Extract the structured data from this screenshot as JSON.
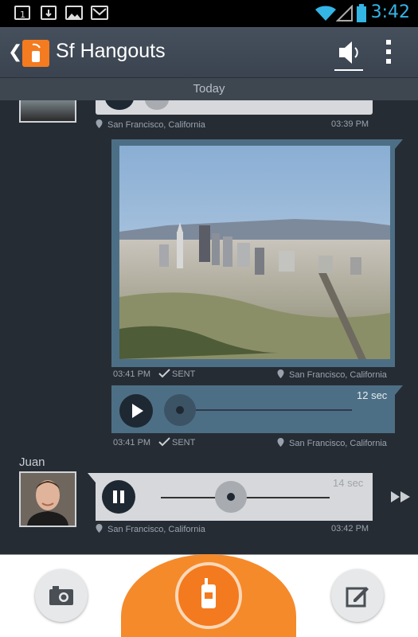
{
  "status_bar": {
    "time": "3:42",
    "notification_icons": [
      "sim-one-icon",
      "download-icon",
      "image-icon",
      "gmail-icon"
    ],
    "system_icons": [
      "wifi-icon",
      "signal-icon",
      "battery-icon"
    ],
    "time_color": "#33b5e5"
  },
  "action_bar": {
    "title": "Sf Hangouts",
    "actions": [
      "speaker-icon",
      "overflow-menu-icon"
    ]
  },
  "conversation": {
    "day_header": "Today",
    "messages": [
      {
        "type": "audio",
        "direction": "received",
        "location": "San Francisco, California",
        "time": "03:39 PM"
      },
      {
        "type": "photo",
        "direction": "sent",
        "time": "03:41 PM",
        "status": "SENT",
        "location": "San Francisco, California"
      },
      {
        "type": "audio",
        "direction": "sent",
        "duration": "12 sec",
        "time": "03:41 PM",
        "status": "SENT",
        "location": "San Francisco, California"
      },
      {
        "type": "audio",
        "direction": "received",
        "sender": "Juan",
        "duration": "14 sec",
        "location": "San Francisco, California",
        "time": "03:42 PM",
        "playback_progress": 0.4
      }
    ]
  },
  "bottom_bar": {
    "actions": [
      "camera-icon",
      "push-to-talk-icon",
      "compose-icon"
    ],
    "accent_color": "#f58a2b"
  }
}
